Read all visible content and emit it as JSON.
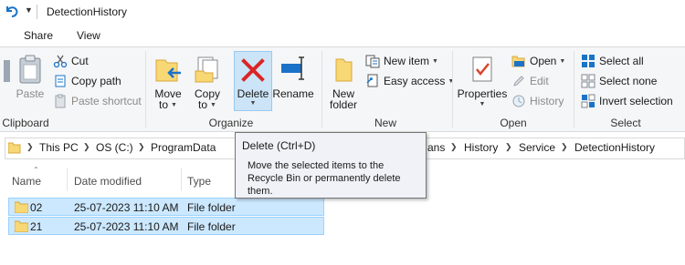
{
  "window": {
    "title": "DetectionHistory"
  },
  "tabs": [
    {
      "label": "Share"
    },
    {
      "label": "View"
    }
  ],
  "ribbon": {
    "clipboard": {
      "group_label": "Clipboard",
      "paste_label": "Paste",
      "cut_label": "Cut",
      "copy_path_label": "Copy path",
      "paste_shortcut_label": "Paste shortcut"
    },
    "organize": {
      "group_label": "Organize",
      "move_to_line1": "Move",
      "move_to_line2": "to",
      "copy_to_line1": "Copy",
      "copy_to_line2": "to",
      "delete_label": "Delete",
      "rename_label": "Rename"
    },
    "new": {
      "group_label": "New",
      "new_folder_line1": "New",
      "new_folder_line2": "folder",
      "new_item_label": "New item",
      "easy_access_label": "Easy access"
    },
    "open": {
      "group_label": "Open",
      "properties_label": "Properties",
      "open_label": "Open",
      "edit_label": "Edit",
      "history_label": "History"
    },
    "select": {
      "group_label": "Select",
      "select_all_label": "Select all",
      "select_none_label": "Select none",
      "invert_selection_label": "Invert selection"
    }
  },
  "address_bar": {
    "crumbs": [
      "This PC",
      "OS (C:)",
      "ProgramData",
      "ans",
      "History",
      "Service",
      "DetectionHistory"
    ]
  },
  "columns": {
    "name": "Name",
    "date_modified": "Date modified",
    "type": "Type"
  },
  "files": [
    {
      "name": "02",
      "date_modified": "25-07-2023 11:10 AM",
      "type": "File folder"
    },
    {
      "name": "21",
      "date_modified": "25-07-2023 11:10 AM",
      "type": "File folder"
    }
  ],
  "tooltip": {
    "title": "Delete (Ctrl+D)",
    "body": "Move the selected items to the Recycle Bin or permanently delete them."
  },
  "colors": {
    "ribbon_bg": "#f5f6f7",
    "selection_bg": "#cce8ff",
    "selection_border": "#99d1ff",
    "delete_red": "#d92626",
    "folder_yellow": "#f8d775",
    "accent_blue": "#1a73c8"
  }
}
